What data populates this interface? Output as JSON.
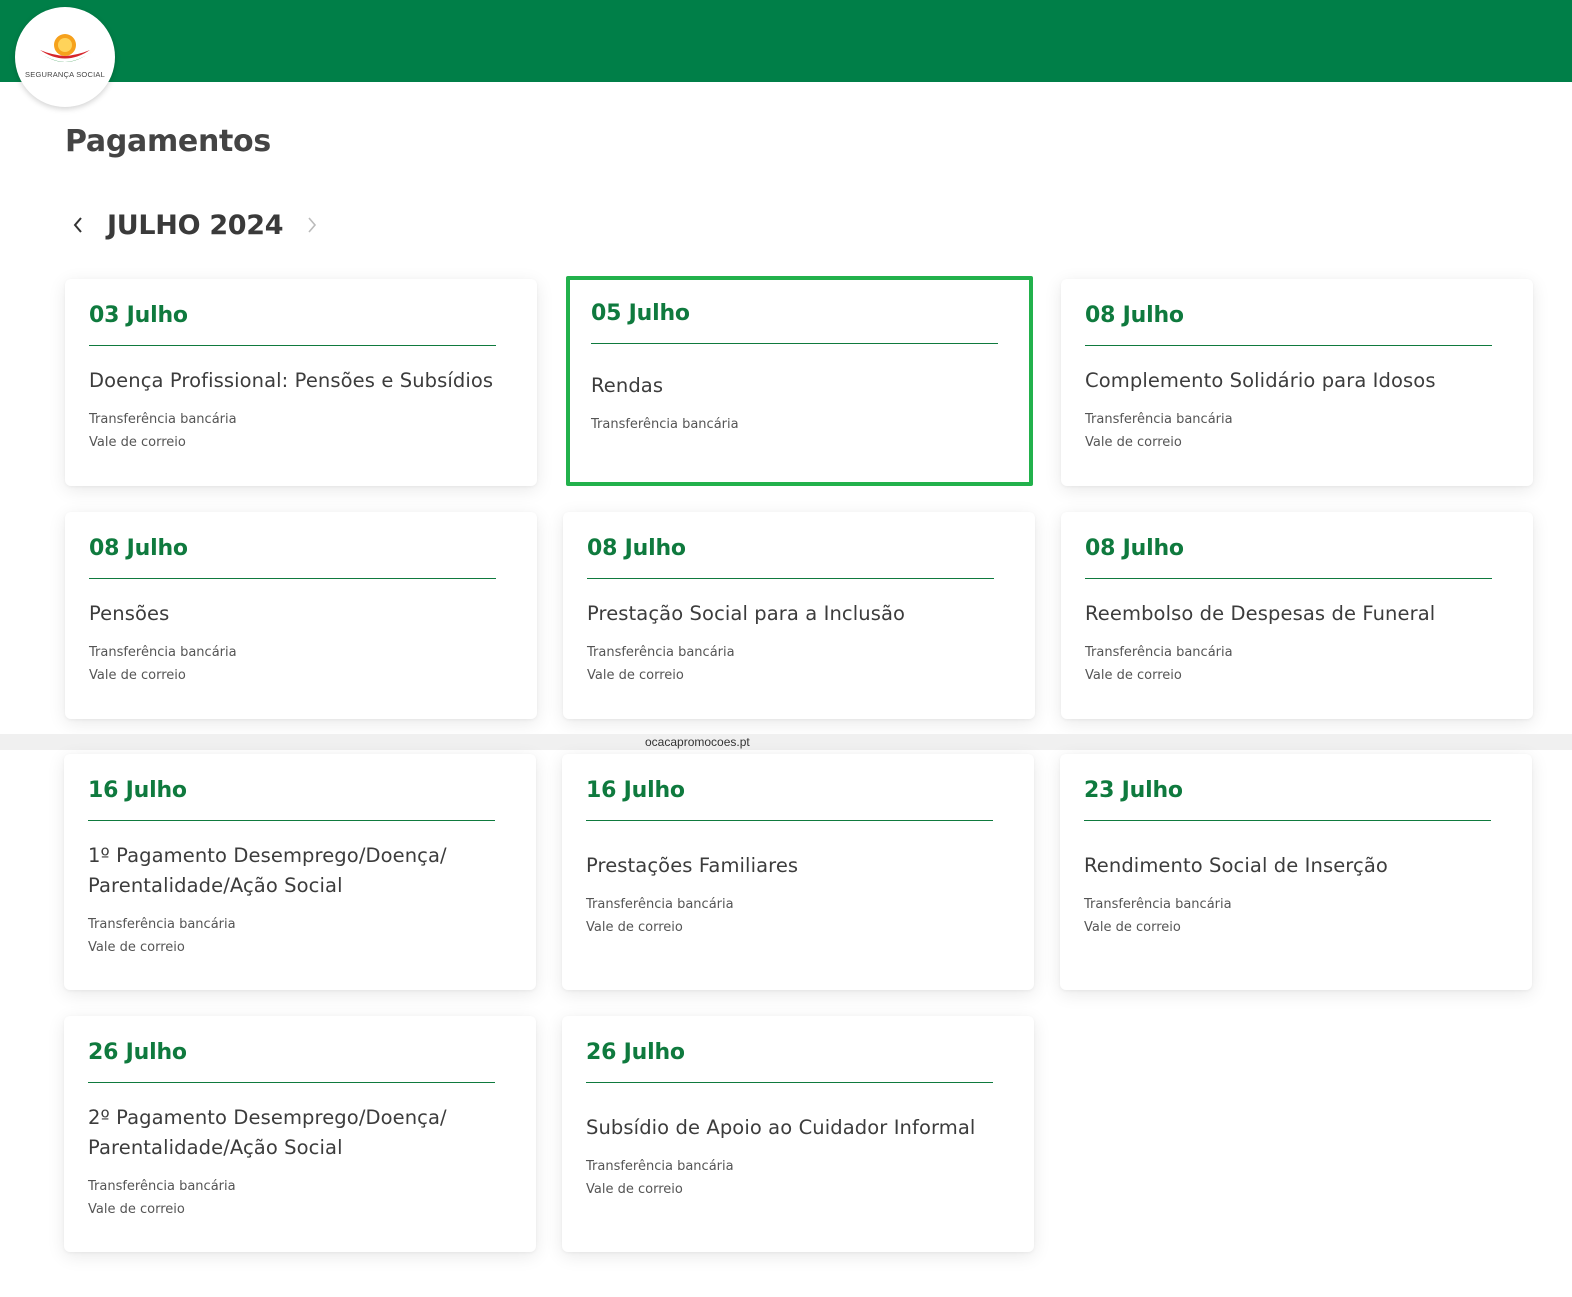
{
  "header": {
    "logo_text": "SEGURANÇA SOCIAL",
    "brand_color": "#007f48"
  },
  "page": {
    "title": "Pagamentos"
  },
  "month_nav": {
    "prev_icon": "chevron-left-icon",
    "next_icon": "chevron-right-icon",
    "label": "JULHO 2024"
  },
  "watermark": "ocacapromocoes.pt",
  "cards": [
    {
      "date": "03 Julho",
      "title": "Doença Profissional: Pensões e Subsídios",
      "methods": [
        "Transferência bancária",
        "Vale de correio"
      ]
    },
    {
      "date": "05 Julho",
      "title": "Rendas",
      "methods": [
        "Transferência bancária"
      ],
      "selected": true
    },
    {
      "date": "08 Julho",
      "title": "Complemento Solidário para Idosos",
      "methods": [
        "Transferência bancária",
        "Vale de correio"
      ]
    },
    {
      "date": "08 Julho",
      "title": "Pensões",
      "methods": [
        "Transferência bancária",
        "Vale de correio"
      ]
    },
    {
      "date": "08 Julho",
      "title": "Prestação Social para a Inclusão",
      "methods": [
        "Transferência bancária",
        "Vale de correio"
      ]
    },
    {
      "date": "08 Julho",
      "title": "Reembolso de Despesas de Funeral",
      "methods": [
        "Transferência bancária",
        "Vale de correio"
      ]
    },
    {
      "date": "16 Julho",
      "title": "1º Pagamento Desemprego/Doença/ Parentalidade/Ação Social",
      "methods": [
        "Transferência bancária",
        "Vale de correio"
      ]
    },
    {
      "date": "16 Julho",
      "title": "Prestações Familiares",
      "methods": [
        "Transferência bancária",
        "Vale de correio"
      ]
    },
    {
      "date": "23 Julho",
      "title": "Rendimento Social de Inserção",
      "methods": [
        "Transferência bancária",
        "Vale de correio"
      ]
    },
    {
      "date": "26 Julho",
      "title": "2º Pagamento Desemprego/Doença/ Parentalidade/Ação Social",
      "methods": [
        "Transferência bancária",
        "Vale de correio"
      ]
    },
    {
      "date": "26 Julho",
      "title": "Subsídio de Apoio ao Cuidador Informal",
      "methods": [
        "Transferência bancária",
        "Vale de correio"
      ]
    }
  ]
}
